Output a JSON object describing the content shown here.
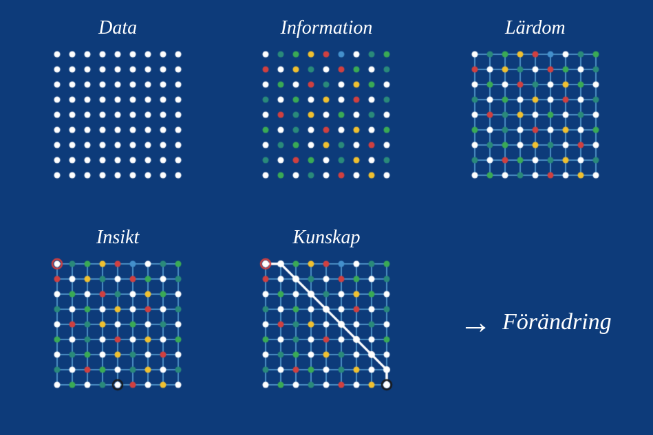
{
  "titles": {
    "data": "Data",
    "information": "Information",
    "lardom": "Lärdom",
    "insikt": "Insikt",
    "kunskap": "Kunskap",
    "forandring": "Förändring"
  },
  "colors": {
    "background": "#0d3b7a",
    "white": "#ffffff",
    "teal": "#2a8a7a",
    "green": "#3aaa55",
    "yellow": "#f0c030",
    "red": "#d04040",
    "blue": "#4490cc",
    "lightblue": "#60aadd",
    "darkblue": "#1a5590"
  }
}
